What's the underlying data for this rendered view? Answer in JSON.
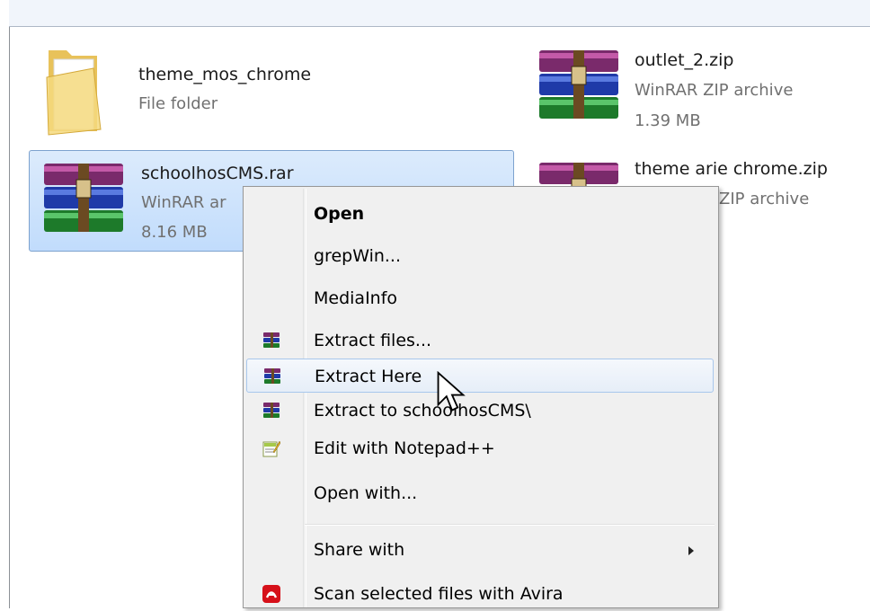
{
  "files": [
    {
      "name": "theme_mos_chrome",
      "type": "File folder",
      "size": "",
      "icon": "folder-icon"
    },
    {
      "name": "outlet_2.zip",
      "type": "WinRAR ZIP archive",
      "size": "1.39 MB",
      "icon": "winrar-archive-icon"
    },
    {
      "name": "schoolhosCMS.rar",
      "type": "WinRAR ar",
      "size": "8.16 MB",
      "icon": "winrar-archive-icon"
    },
    {
      "name": "theme arie chrome.zip",
      "type": "ZIP archive",
      "size": "",
      "icon": "winrar-archive-icon"
    }
  ],
  "context_menu": {
    "items": [
      {
        "label": "Open",
        "bold": true,
        "icon": ""
      },
      {
        "label": "grepWin...",
        "icon": ""
      },
      {
        "label": "MediaInfo",
        "icon": ""
      },
      {
        "label": "Extract files...",
        "icon": "winrar-small-icon"
      },
      {
        "label": "Extract Here",
        "icon": "winrar-small-icon",
        "hovered": true
      },
      {
        "label": "Extract to schoolhosCMS\\",
        "icon": "winrar-small-icon"
      },
      {
        "label": "Edit with Notepad++",
        "icon": "notepad-plus-plus-icon"
      },
      {
        "label": "Open with...",
        "icon": ""
      },
      {
        "label": "Share with",
        "icon": "",
        "submenu": true
      },
      {
        "label": "Scan selected files with Avira",
        "icon": "avira-icon"
      }
    ]
  },
  "colors": {
    "selection": "#cce3fc",
    "menu_background": "#f0f0f0",
    "avira_red": "#d6111a"
  }
}
